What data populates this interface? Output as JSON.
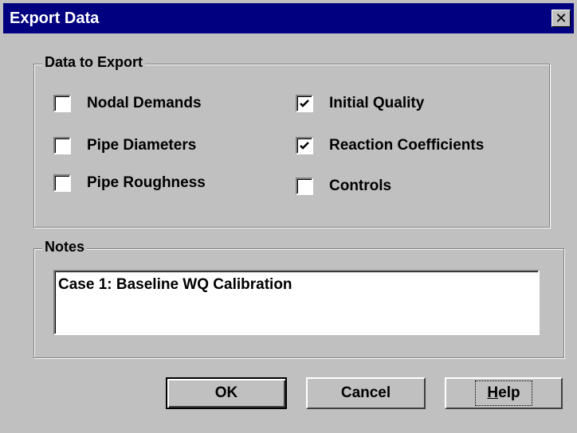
{
  "window": {
    "title": "Export Data"
  },
  "data_group": {
    "label": "Data to Export",
    "items": [
      {
        "label": "Nodal Demands",
        "checked": false
      },
      {
        "label": "Pipe Diameters",
        "checked": false
      },
      {
        "label": "Pipe Roughness",
        "checked": false
      },
      {
        "label": "Initial Quality",
        "checked": true
      },
      {
        "label": "Reaction Coefficients",
        "checked": true
      },
      {
        "label": "Controls",
        "checked": false
      }
    ]
  },
  "notes_group": {
    "label": "Notes",
    "value": "Case 1: Baseline WQ Calibration"
  },
  "buttons": {
    "ok": "OK",
    "cancel": "Cancel",
    "help_accel": "H",
    "help_rest": "elp"
  }
}
